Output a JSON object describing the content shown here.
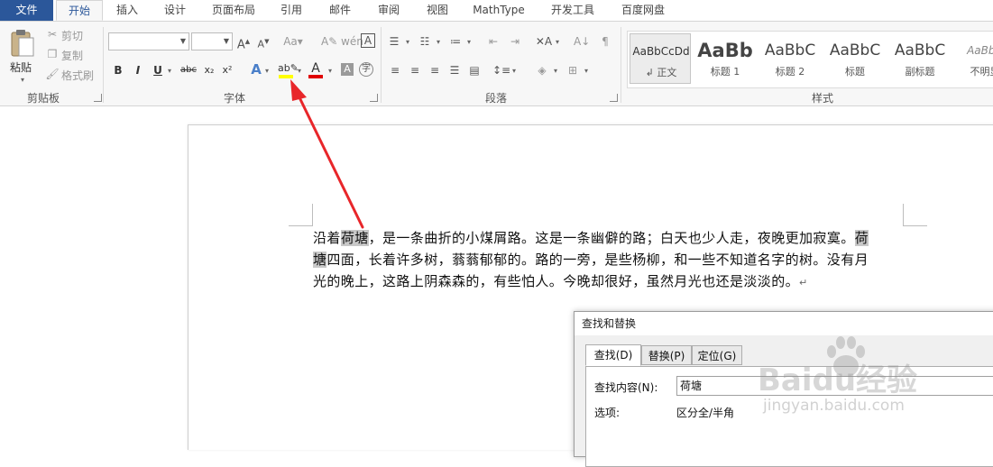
{
  "tabs": [
    {
      "label": "文件"
    },
    {
      "label": "开始"
    },
    {
      "label": "插入"
    },
    {
      "label": "设计"
    },
    {
      "label": "页面布局"
    },
    {
      "label": "引用"
    },
    {
      "label": "邮件"
    },
    {
      "label": "审阅"
    },
    {
      "label": "视图"
    },
    {
      "label": "MathType"
    },
    {
      "label": "开发工具"
    },
    {
      "label": "百度网盘"
    }
  ],
  "clipboard": {
    "paste": "粘贴",
    "cut": "剪切",
    "copy": "复制",
    "format_painter": "格式刷",
    "group_label": "剪贴板"
  },
  "font": {
    "group_label": "字体",
    "font_name": "",
    "font_size": "",
    "bold": "B",
    "italic": "I",
    "underline": "U",
    "strike": "abc",
    "subscript": "x₂",
    "superscript": "x²",
    "highlight_color": "#ffff00",
    "font_color": "#e00000"
  },
  "paragraph": {
    "group_label": "段落"
  },
  "styles": {
    "group_label": "样式",
    "items": [
      {
        "preview": "AaBbCcDd",
        "name": "↲ 正文"
      },
      {
        "preview": "AaBb",
        "name": "标题 1"
      },
      {
        "preview": "AaBbC",
        "name": "标题 2"
      },
      {
        "preview": "AaBbC",
        "name": "标题"
      },
      {
        "preview": "AaBbC",
        "name": "副标题"
      },
      {
        "preview": "AaBbC",
        "name": "不明显"
      }
    ]
  },
  "document": {
    "line1_pre": "沿着",
    "line1_hl": "荷塘",
    "line1_post": "，是一条曲折的小煤屑路。这是一条幽僻的路；白天也少人走，夜晚更加寂寞。",
    "line1_hl2": "荷",
    "line2_hl": "塘",
    "line2_post": "四面，长着许多树，蓊蓊郁郁的。路的一旁，是些杨柳，和一些不知道名字的树。没有月",
    "line3": "光的晚上，这路上阴森森的，有些怕人。今晚却很好，虽然月光也还是淡淡的。",
    "para_mark": "↵"
  },
  "dialog": {
    "title": "查找和替换",
    "tabs": [
      {
        "label": "查找(D)"
      },
      {
        "label": "替换(P)"
      },
      {
        "label": "定位(G)"
      }
    ],
    "find_label": "查找内容(N):",
    "find_value": "荷塘",
    "options_label": "选项:",
    "options_value": "区分全/半角"
  },
  "watermark": {
    "brand": "Baidu经验",
    "url": "jingyan.baidu.com"
  },
  "colors": {
    "accent": "#2b579a",
    "arrow": "#e8262a"
  }
}
